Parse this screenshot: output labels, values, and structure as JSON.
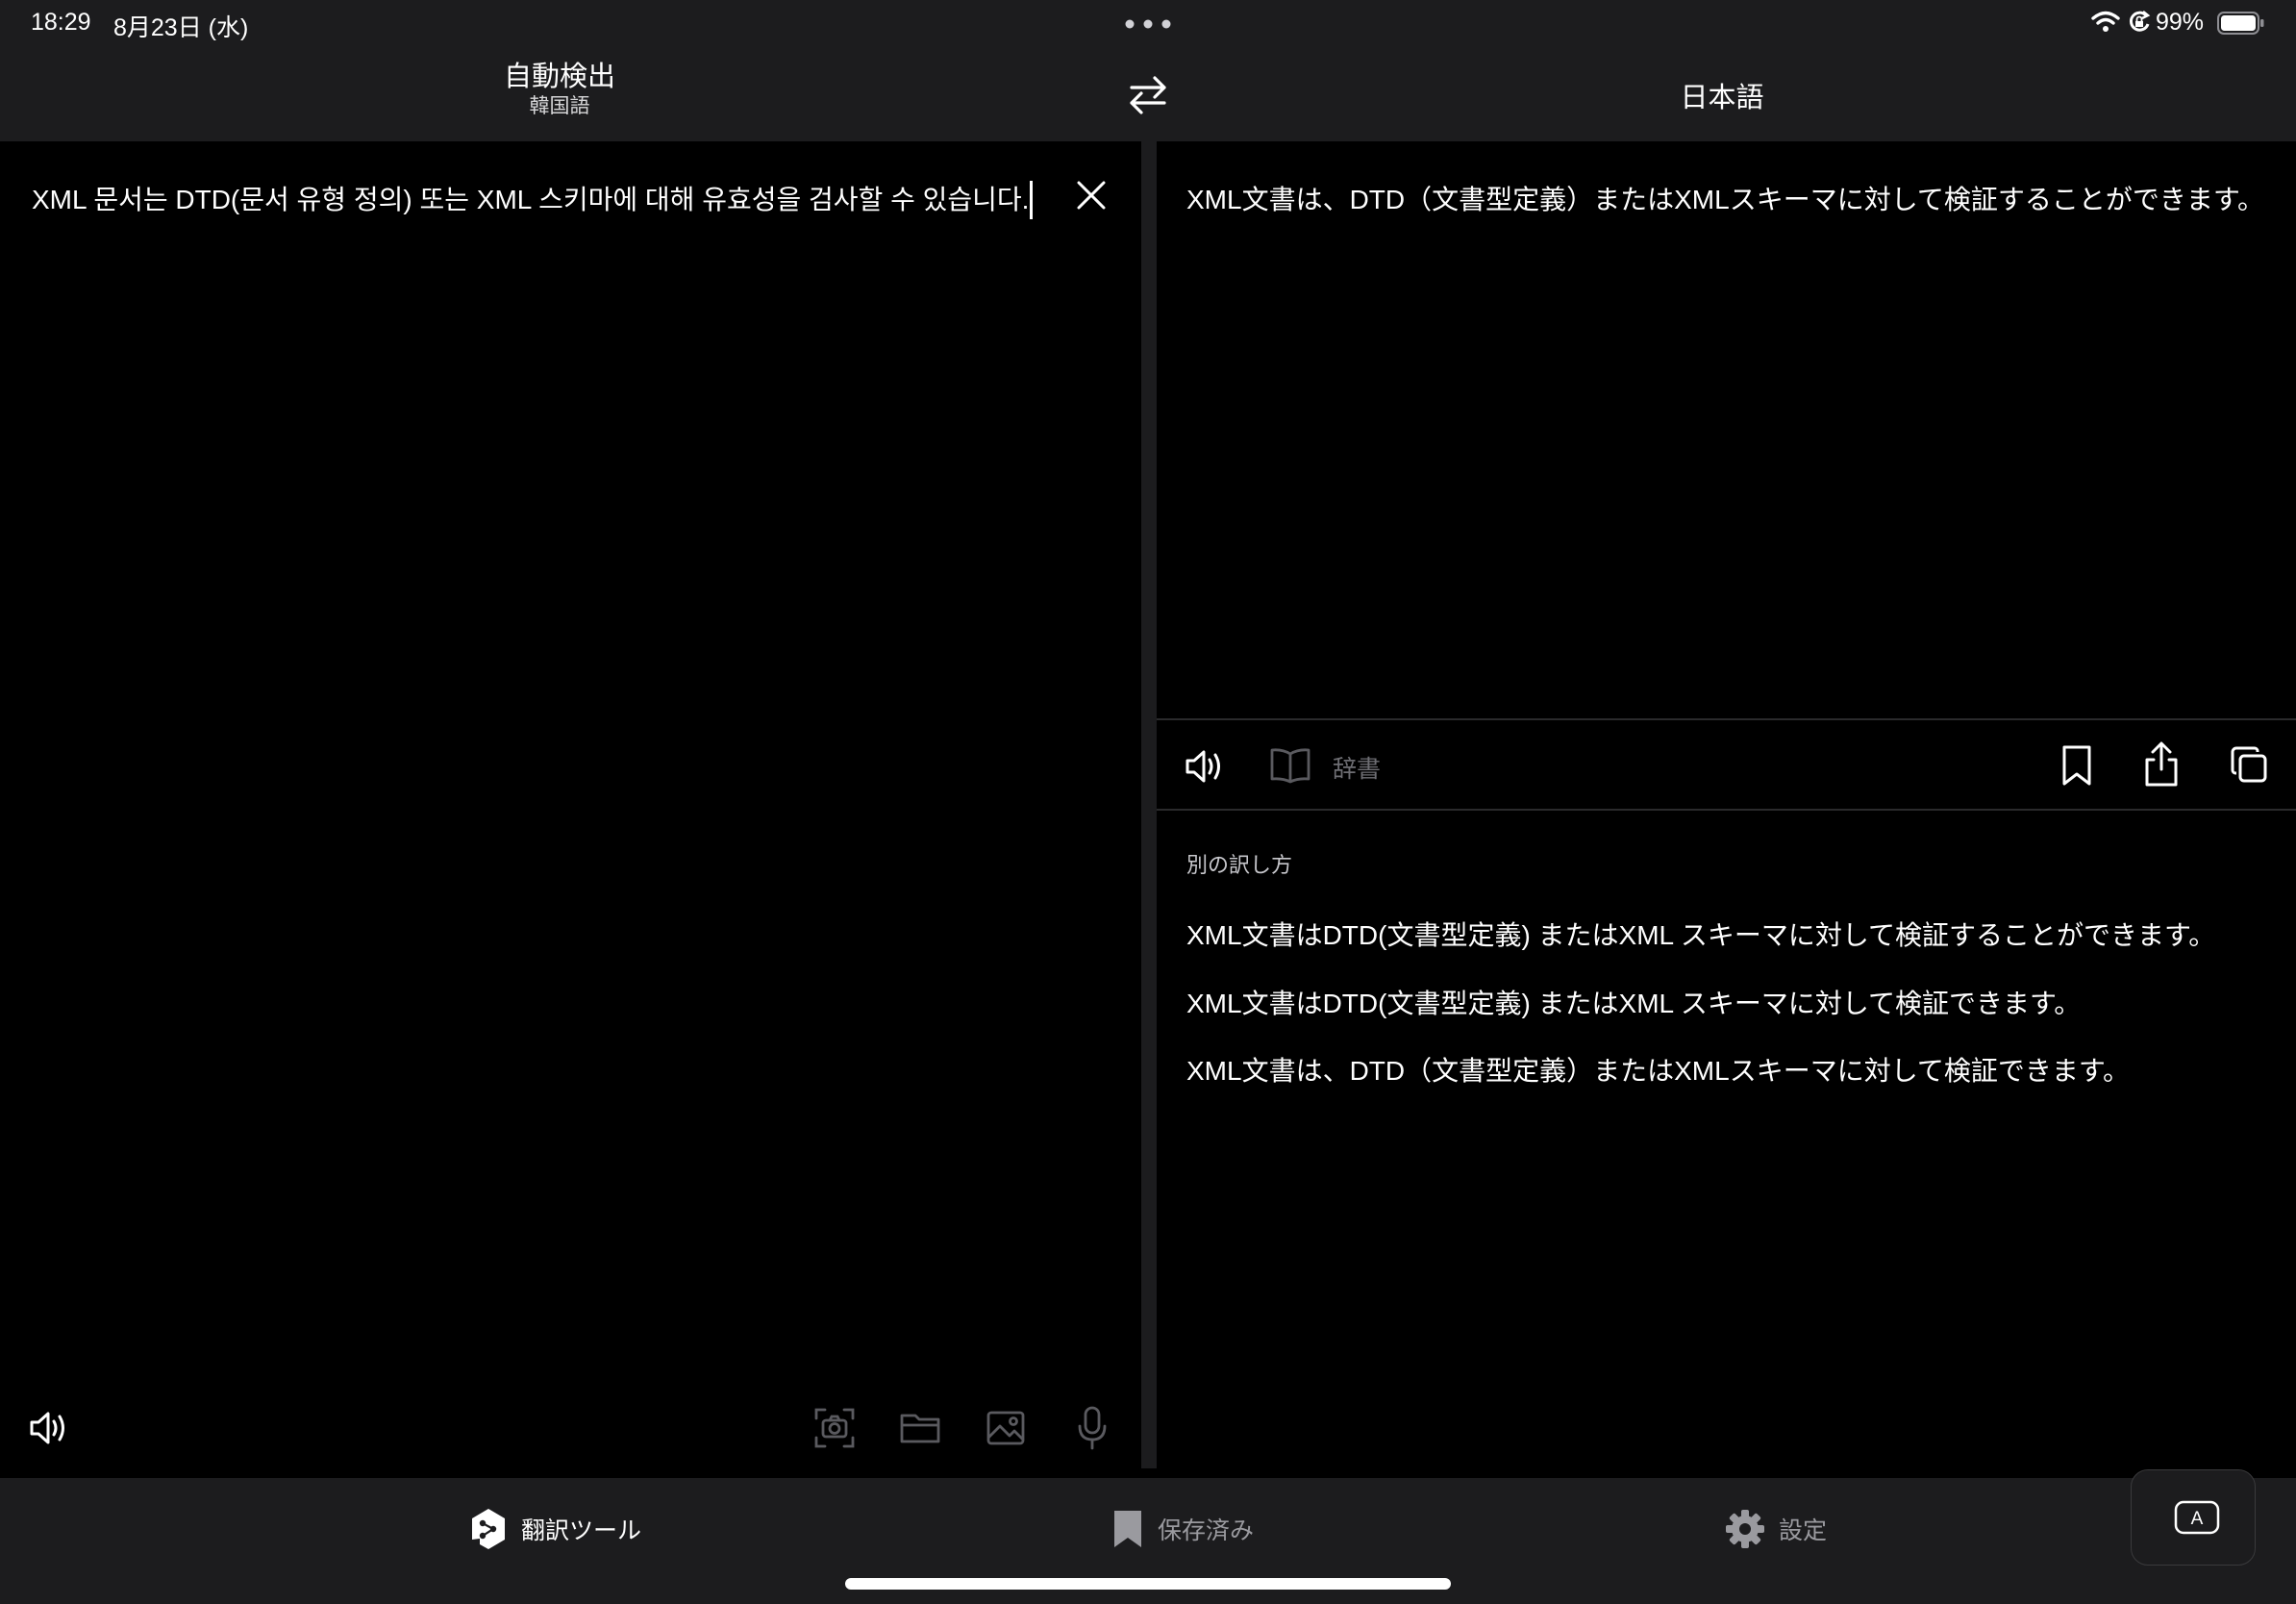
{
  "status_bar": {
    "time": "18:29",
    "date": "8月23日 (水)",
    "battery": "99%"
  },
  "header": {
    "source_language": "自動検出",
    "detected_language": "韓国語",
    "target_language": "日本語"
  },
  "source": {
    "text": "XML 문서는 DTD(문서 유형 정의) 또는 XML 스키마에 대해 유효성을 검사할 수 있습니다."
  },
  "target": {
    "text": "XML文書は、DTD（文書型定義）またはXMLスキーマに対して検証することができます。",
    "dictionary_label": "辞書",
    "alternatives_heading": "別の訳し方",
    "alternatives": [
      "XML文書はDTD(文書型定義) またはXML スキーマに対して検証することができます。",
      "XML文書はDTD(文書型定義) またはXML スキーマに対して検証できます。",
      "XML文書は、DTD（文書型定義）またはXMLスキーマに対して検証できます。"
    ]
  },
  "tabs": [
    {
      "label": "翻訳ツール",
      "icon": "deepl-logo-icon",
      "active": true
    },
    {
      "label": "保存済み",
      "icon": "bookmark-icon",
      "active": false
    },
    {
      "label": "設定",
      "icon": "gear-icon",
      "active": false
    }
  ],
  "keyboard_button_label": "A",
  "colors": {
    "background": "#000000",
    "bar": "#1c1c1e",
    "text": "#ffffff",
    "muted": "#6e6e73"
  }
}
